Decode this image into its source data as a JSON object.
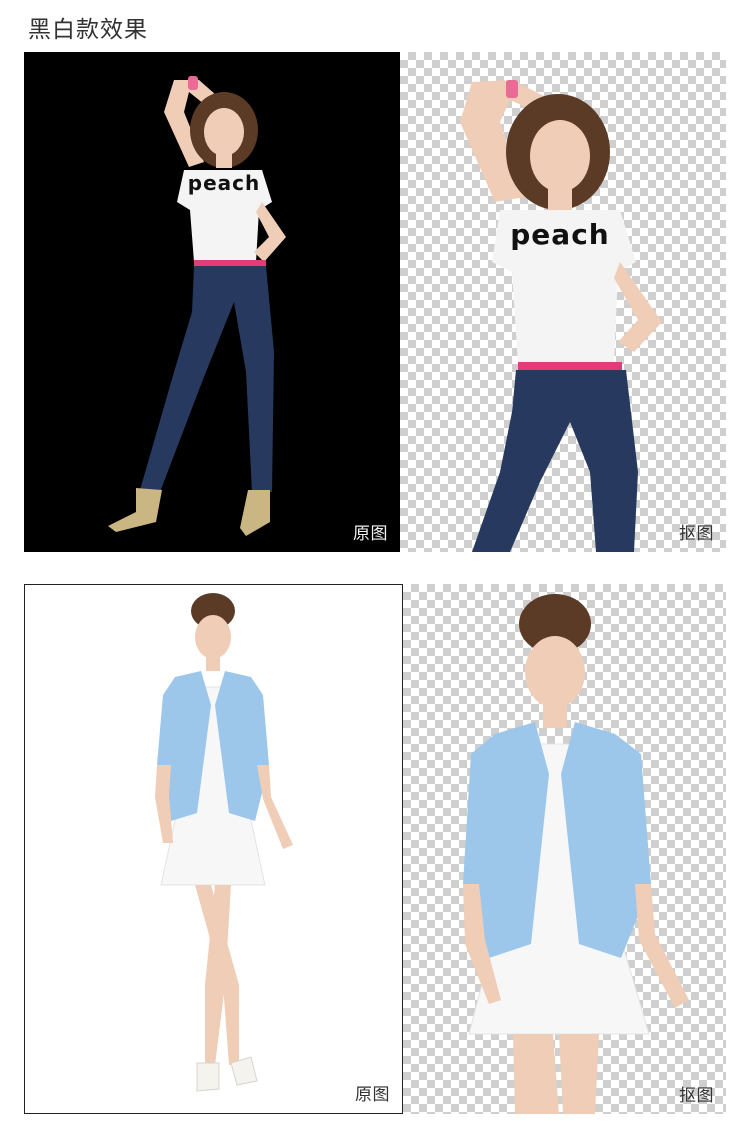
{
  "page": {
    "title": "黑白款效果"
  },
  "rows": [
    {
      "original": {
        "label": "原图",
        "background": "black"
      },
      "cutout": {
        "label": "抠图",
        "background": "transparent"
      },
      "shirt_text": "peach"
    },
    {
      "original": {
        "label": "原图",
        "background": "white"
      },
      "cutout": {
        "label": "抠图",
        "background": "transparent"
      }
    }
  ],
  "colors": {
    "shirt": "#f4f4f4",
    "jeans": "#27395e",
    "belt": "#e23d7a",
    "skin": "#f0cdb6",
    "hair": "#5b3a26",
    "blazer": "#9cc7ea",
    "dress": "#f7f7f7"
  }
}
